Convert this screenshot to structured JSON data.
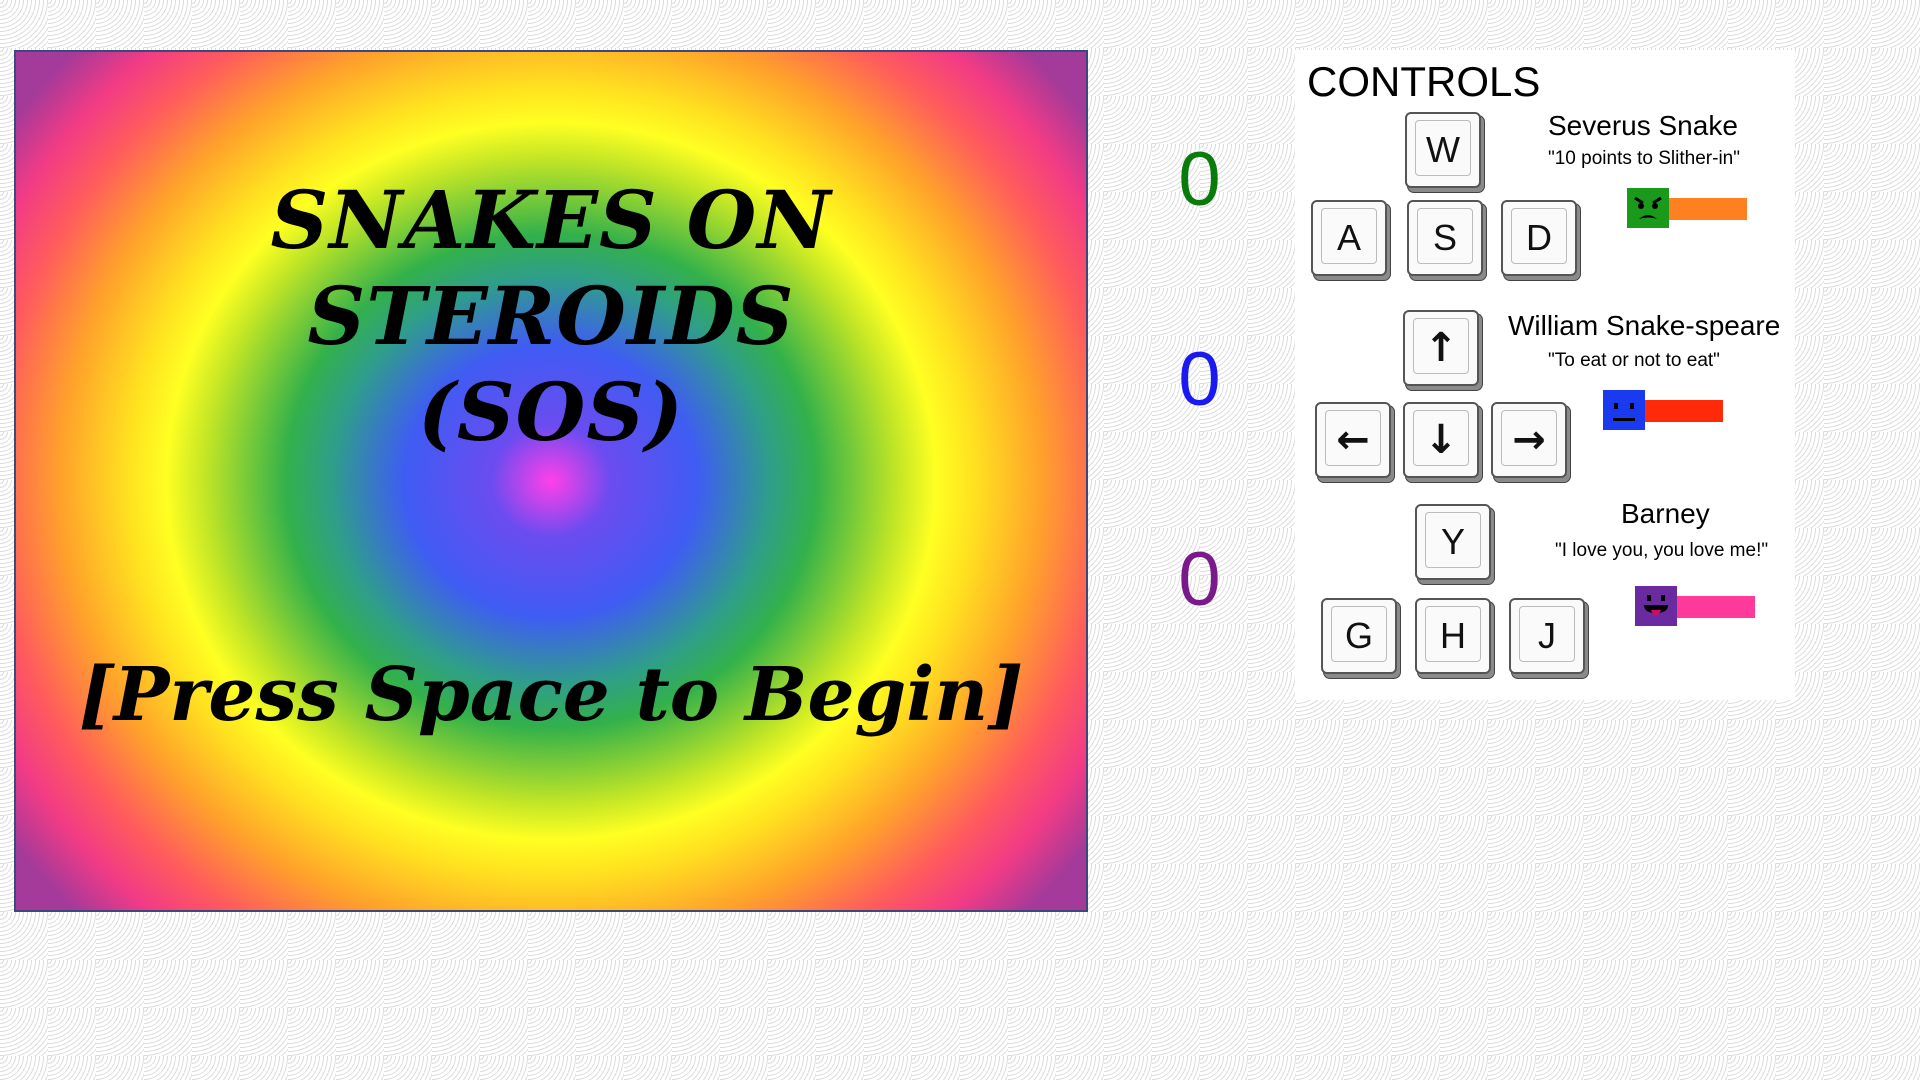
{
  "game": {
    "title": "SNAKES ON\nSTEROIDS\n(SOS)",
    "prompt": "[Press Space to Begin]"
  },
  "scores": [
    {
      "value": "0",
      "color": "#0a7a0a"
    },
    {
      "value": "0",
      "color": "#1a1af0"
    },
    {
      "value": "0",
      "color": "#7a1a8a"
    }
  ],
  "controls": {
    "heading": "CONTROLS",
    "players": [
      {
        "name": "Severus Snake",
        "quote": "\"10 points to Slither-in\"",
        "keys": {
          "up": "W",
          "left": "A",
          "down": "S",
          "right": "D"
        },
        "head_color": "#1a9a1a",
        "body_color": "#ff8020",
        "face": "angry-face-icon"
      },
      {
        "name": "William Snake-speare",
        "quote": "\"To eat or not to eat\"",
        "keys": {
          "up": "↑",
          "left": "←",
          "down": "↓",
          "right": "→"
        },
        "head_color": "#1a3af0",
        "body_color": "#ff2a0a",
        "face": "neutral-face-icon"
      },
      {
        "name": "Barney",
        "quote": "\"I love you, you love me!\"",
        "keys": {
          "up": "Y",
          "left": "G",
          "down": "H",
          "right": "J"
        },
        "head_color": "#6a2aa0",
        "body_color": "#ff3a9a",
        "face": "tongue-face-icon"
      }
    ]
  }
}
